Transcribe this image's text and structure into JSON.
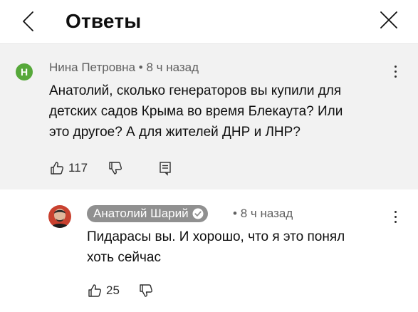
{
  "header": {
    "title": "Ответы",
    "back_icon": "chevron-left-icon",
    "close_icon": "close-icon"
  },
  "comments": [
    {
      "author": "Нина Петровна",
      "avatar_letter": "Н",
      "avatar_color": "#56a83a",
      "separator": "•",
      "time": "8 ч назад",
      "text_lines": [
        "Анатолий, сколько генераторов вы купили для",
        "детских садов Крыма во время Блекаута? Или",
        "это другое? А для жителей ДНР и ЛНР?"
      ],
      "likes": "117",
      "icons": [
        "thumb-up-icon",
        "thumb-down-icon",
        "reply-icon",
        "more-vertical-icon"
      ]
    },
    {
      "author": "Анатолий Шарий",
      "verified": true,
      "separator": "•",
      "time": "8 ч назад",
      "text_lines": [
        "Пидарасы вы. И хорошо, что я это понял",
        "хоть сейчас"
      ],
      "likes": "25",
      "icons": [
        "thumb-up-icon",
        "thumb-down-icon",
        "more-vertical-icon"
      ]
    }
  ],
  "colors": {
    "main_comment_bg": "#f2f2f2",
    "author_pill_bg": "#909090",
    "meta_text": "#606060"
  }
}
